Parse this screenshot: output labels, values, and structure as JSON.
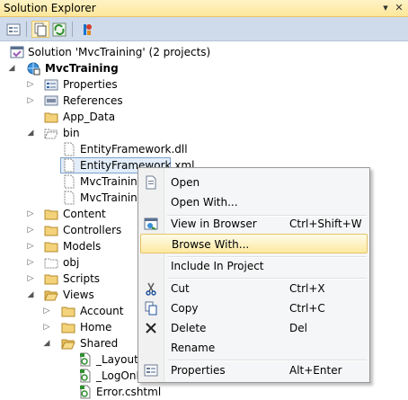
{
  "window": {
    "title": "Solution Explorer",
    "pin_glyph": "▾",
    "close_glyph": "✕"
  },
  "toolbar": {
    "buttons": [
      "properties-icon",
      "show-all-files-icon",
      "refresh-icon",
      "view-class-diagram-icon"
    ]
  },
  "tree": {
    "solution": "Solution 'MvcTraining' (2 projects)",
    "project": "MvcTraining",
    "items": {
      "properties": "Properties",
      "references": "References",
      "app_data": "App_Data",
      "bin": "bin",
      "ef_dll": "EntityFramework.dll",
      "ef_xml": "EntityFramework.xml",
      "mvc1": "MvcTraining",
      "mvc2": "MvcTraining",
      "content": "Content",
      "controllers": "Controllers",
      "models": "Models",
      "obj": "obj",
      "scripts": "Scripts",
      "views": "Views",
      "account": "Account",
      "home": "Home",
      "shared": "Shared",
      "layout": "_Layout.",
      "logon": "_LogOnP",
      "error": "Error.cshtml"
    }
  },
  "context_menu": {
    "open": "Open",
    "open_with": "Open With...",
    "view_in_browser": "View in Browser",
    "view_in_browser_key": "Ctrl+Shift+W",
    "browse_with": "Browse With...",
    "include_in_project": "Include In Project",
    "cut": "Cut",
    "cut_key": "Ctrl+X",
    "copy": "Copy",
    "copy_key": "Ctrl+C",
    "delete": "Delete",
    "delete_key": "Del",
    "rename": "Rename",
    "properties": "Properties",
    "properties_key": "Alt+Enter"
  },
  "colors": {
    "titlebar": "#fde79a",
    "toolbar": "#cfdbea",
    "highlight": "#fde9a2",
    "selection": "#e2edf9"
  }
}
